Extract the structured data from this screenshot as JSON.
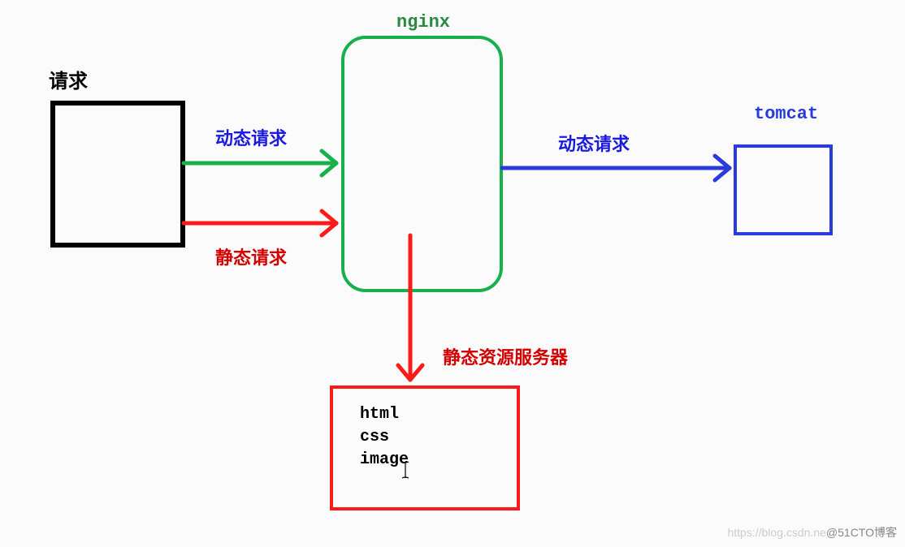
{
  "nodes": {
    "request_label": "请求",
    "nginx_label": "nginx",
    "tomcat_label": "tomcat",
    "static_server_label": "静态资源服务器",
    "static_files": {
      "line1": "html",
      "line2": "css",
      "line3": "image"
    }
  },
  "edges": {
    "dynamic_to_nginx": "动态请求",
    "static_to_nginx": "静态请求",
    "dynamic_to_tomcat": "动态请求"
  },
  "colors": {
    "black": "#000000",
    "green": "#17b04b",
    "red": "#ff1a1a",
    "blue": "#2a3bdc",
    "nginx_text": "#2a8a3f",
    "edge_label_blue": "#1a1ae0",
    "edge_label_red": "#d40000"
  },
  "watermark": {
    "faint": "https://blog.csdn.ne",
    "dark": "@51CTO博客"
  }
}
